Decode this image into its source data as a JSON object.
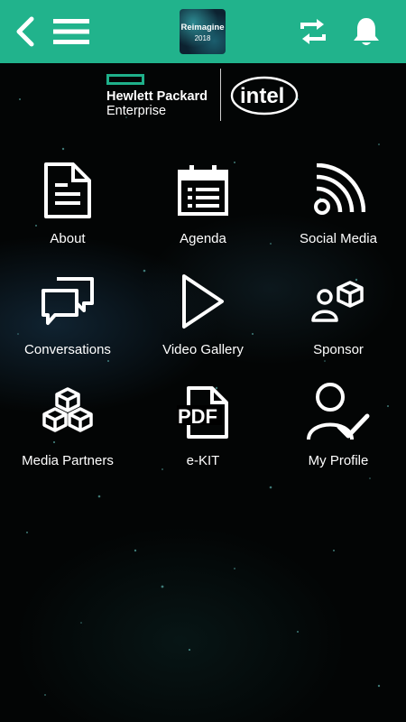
{
  "colors": {
    "accent": "#21b38c",
    "background": "#030505",
    "icon": "#ffffff"
  },
  "topbar": {
    "back_icon": "chevron-left-icon",
    "menu_icon": "hamburger-menu-icon",
    "event_logo": {
      "line1": "Reimagine",
      "line2": "2018"
    },
    "sync_icon": "sync-arrows-icon",
    "notification_icon": "bell-icon"
  },
  "brand": {
    "hpe_line1": "Hewlett Packard",
    "hpe_line2": "Enterprise",
    "intel": "intel"
  },
  "tiles": [
    {
      "label": "About",
      "icon": "document-icon"
    },
    {
      "label": "Agenda",
      "icon": "calendar-list-icon"
    },
    {
      "label": "Social Media",
      "icon": "rss-feed-icon"
    },
    {
      "label": "Conversations",
      "icon": "chat-bubbles-icon"
    },
    {
      "label": "Video Gallery",
      "icon": "play-icon"
    },
    {
      "label": "Sponsor",
      "icon": "person-cube-icon"
    },
    {
      "label": "Media Partners",
      "icon": "stacked-cubes-icon"
    },
    {
      "label": "e-KIT",
      "icon": "pdf-file-icon"
    },
    {
      "label": "My Profile",
      "icon": "user-check-icon"
    }
  ]
}
